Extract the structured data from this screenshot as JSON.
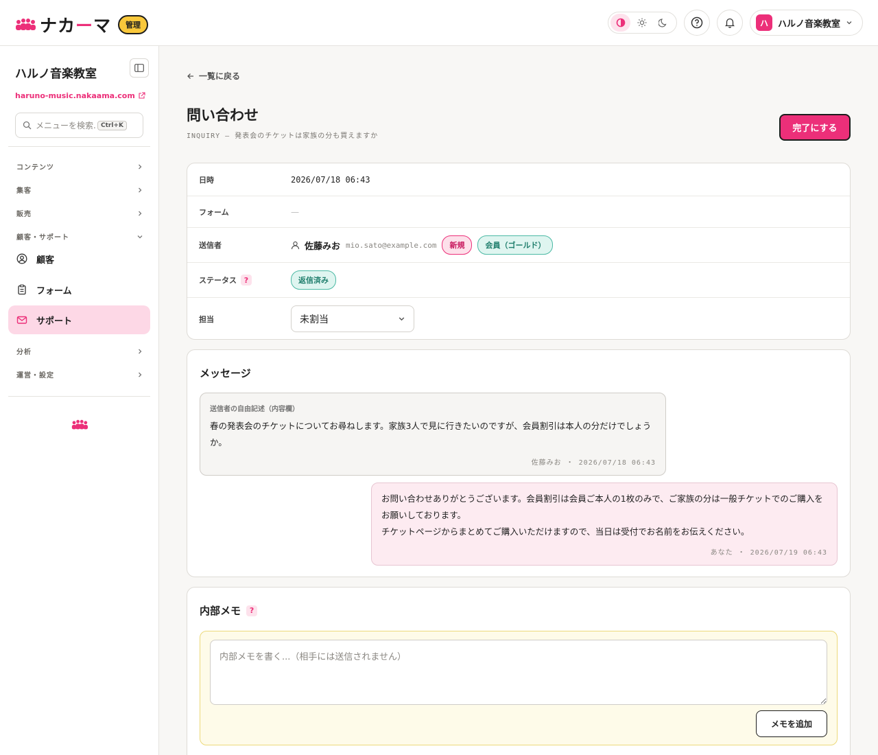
{
  "header": {
    "brand_name_a": "ナカ",
    "brand_name_b": "ー",
    "brand_name_c": "マ",
    "admin_badge": "管理",
    "account_initial": "ハ",
    "account_name": "ハルノ音楽教室"
  },
  "sidebar": {
    "org_name": "ハルノ音楽教室",
    "org_url": "haruno-music.nakaama.com",
    "search_placeholder": "メニューを検索...",
    "search_shortcut": "Ctrl+K",
    "groups": {
      "content": "コンテンツ",
      "attract": "集客",
      "sales": "販売",
      "customer_support": "顧客・サポート",
      "analytics": "分析",
      "operations": "運営・設定"
    },
    "items": {
      "customers": "顧客",
      "forms": "フォーム",
      "support": "サポート"
    }
  },
  "main": {
    "back_label": "一覧に戻る",
    "title": "問い合わせ",
    "subtitle": "INQUIRY — 発表会のチケットは家族の分も買えますか",
    "done_button": "完了にする",
    "info": {
      "datetime_label": "日時",
      "datetime_value": "2026/07/18 06:43",
      "form_label": "フォーム",
      "form_value": "—",
      "sender_label": "送信者",
      "sender_name": "佐藤みお",
      "sender_email": "mio.sato@example.com",
      "sender_badge_new": "新規",
      "sender_badge_member": "会員（ゴールド）",
      "status_label": "ステータス",
      "status_help": "?",
      "status_value": "返信済み",
      "assignee_label": "担当",
      "assignee_value": "未割当"
    },
    "messages": {
      "title": "メッセージ",
      "incoming": {
        "header": "送信者の自由記述（内容欄）",
        "body": "春の発表会のチケットについてお尋ねします。家族3人で見に行きたいのですが、会員割引は本人の分だけでしょうか。",
        "meta": "佐藤みお ・ 2026/07/18 06:43"
      },
      "outgoing": {
        "body_line1": "お問い合わせありがとうございます。会員割引は会員ご本人の1枚のみで、ご家族の分は一般チケットでのご購入をお願いしております。",
        "body_line2": "チケットページからまとめてご購入いただけますので、当日は受付でお名前をお伝えください。",
        "meta": "あなた ・ 2026/07/19 06:43"
      }
    },
    "memo": {
      "title": "内部メモ",
      "help": "?",
      "placeholder": "内部メモを書く...（相手には送信されません）",
      "add_button": "メモを追加"
    }
  },
  "colors": {
    "accent": "#ec2f79",
    "badge_yellow": "#f9c83b",
    "teal": "#1f7e6c",
    "active_nav": "#fdd8e6"
  }
}
